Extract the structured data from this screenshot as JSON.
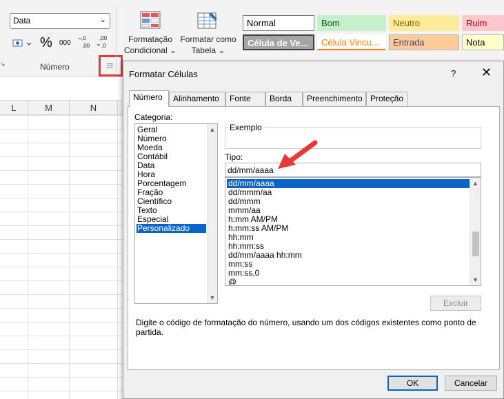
{
  "ribbon": {
    "number_format_value": "Data",
    "percent_symbol": "%",
    "thousands_symbol": "000",
    "decrease_decimal": "←,0",
    "increase_decimal": ",00",
    "group_label": "Número",
    "conditional_formatting": {
      "line1": "Formatação",
      "line2": "Condicional ⌄"
    },
    "format_as_table": {
      "line1": "Formatar como",
      "line2": "Tabela ⌄"
    },
    "cell_styles": [
      {
        "label": "Normal",
        "bg": "#ffffff",
        "color": "#000000",
        "border": "#7a7a7a"
      },
      {
        "label": "Bom",
        "bg": "#c6efce",
        "color": "#006100",
        "border": "#c6efce"
      },
      {
        "label": "Neutro",
        "bg": "#ffeb9c",
        "color": "#9c5700",
        "border": "#ffeb9c"
      },
      {
        "label": "Ruim",
        "bg": "#ffc7ce",
        "color": "#9c0006",
        "border": "#ffc7ce"
      },
      {
        "label": "Célula de Ve...",
        "bg": "#a5a5a5",
        "color": "#ffffff",
        "border": "#3f3f3f"
      },
      {
        "label": "Célula Vincu...",
        "bg": "#ffffff",
        "color": "#fa7d00",
        "border": "#ffffff"
      },
      {
        "label": "Entrada",
        "bg": "#ffcc99",
        "color": "#3f3f76",
        "border": "#b0b0b0"
      },
      {
        "label": "Nota",
        "bg": "#ffffcc",
        "color": "#000000",
        "border": "#b2b2b2"
      }
    ]
  },
  "sheet": {
    "columns": [
      "L",
      "M",
      "N"
    ]
  },
  "dialog": {
    "title": "Formatar Células",
    "help": "?",
    "close": "✕",
    "tabs": [
      "Número",
      "Alinhamento",
      "Fonte",
      "Borda",
      "Preenchimento",
      "Proteção"
    ],
    "active_tab": "Número",
    "category_label": "Categoria:",
    "categories": [
      "Geral",
      "Número",
      "Moeda",
      "Contábil",
      "Data",
      "Hora",
      "Porcentagem",
      "Fração",
      "Científico",
      "Texto",
      "Especial",
      "Personalizado"
    ],
    "selected_category": "Personalizado",
    "example_label": "Exemplo",
    "type_label": "Tipo:",
    "type_value": "dd/mm/aaaa",
    "type_options": [
      "dd/mm/aaaa",
      "dd/mmm/aa",
      "dd/mmm",
      "mmm/aa",
      "h:mm AM/PM",
      "h:mm:ss AM/PM",
      "hh:mm",
      "hh:mm:ss",
      "dd/mm/aaaa hh:mm",
      "mm:ss",
      "mm:ss,0",
      "@"
    ],
    "selected_type": "dd/mm/aaaa",
    "delete_button": "Excluir",
    "description": "Digite o código de formatação do número, usando um dos códigos existentes como ponto de partida.",
    "ok_button": "OK",
    "cancel_button": "Cancelar",
    "annotation_arrow_color": "#e53935",
    "selection_color": "#0a64c8"
  }
}
